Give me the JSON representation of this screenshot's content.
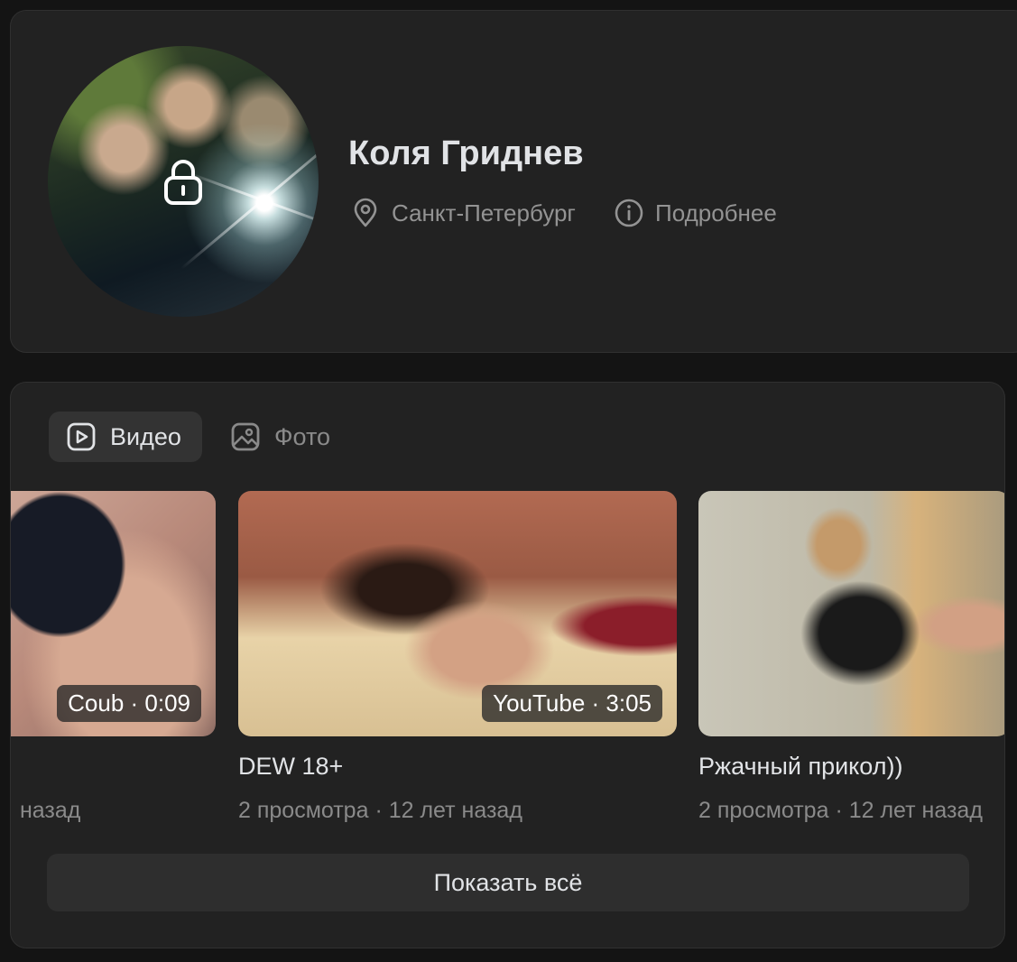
{
  "profile": {
    "name": "Коля Гриднев",
    "city": "Санкт-Петербург",
    "details_label": "Подробнее",
    "avatar_locked": true
  },
  "media": {
    "tabs": [
      {
        "label": "Видео",
        "icon": "video-icon",
        "active": true
      },
      {
        "label": "Фото",
        "icon": "photo-icon",
        "active": false
      }
    ],
    "videos": [
      {
        "title": "",
        "badge": "Coub · 0:09",
        "meta": "назад"
      },
      {
        "title": "DEW 18+",
        "badge": "YouTube · 3:05",
        "meta": "2 просмотра · 12 лет назад"
      },
      {
        "title": "Ржачный прикол))",
        "badge": "",
        "meta": "2 просмотра · 12 лет назад"
      }
    ],
    "show_all_label": "Показать всё"
  },
  "colors": {
    "page_bg": "#141414",
    "card_bg": "#222222",
    "active_tab_bg": "#333333",
    "muted_text": "#939393",
    "primary_text": "#e1e3e6"
  }
}
